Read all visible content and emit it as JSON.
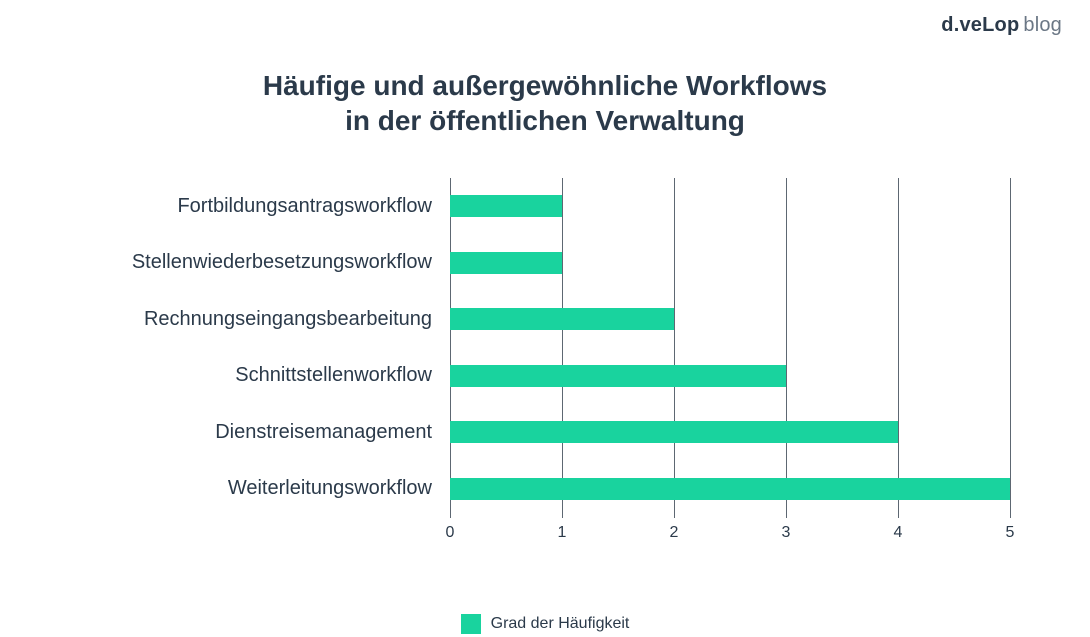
{
  "brand": {
    "bold": "d.veLop",
    "light": "blog"
  },
  "title": {
    "line1": "Häufige und außergewöhnliche Workflows",
    "line2": "in der öffentlichen Verwaltung"
  },
  "legend": {
    "label": "Grad der Häufigkeit"
  },
  "chart_data": {
    "type": "bar",
    "orientation": "horizontal",
    "categories": [
      "Fortbildungsantragsworkflow",
      "Stellenwiederbesetzungsworkflow",
      "Rechnungseingangsbearbeitung",
      "Schnittstellenworkflow",
      "Dienstreisemanagement",
      "Weiterleitungsworkflow"
    ],
    "values": [
      1,
      1,
      2,
      3,
      4,
      5
    ],
    "series_name": "Grad der Häufigkeit",
    "xlabel": "",
    "ylabel": "",
    "xlim": [
      0,
      5
    ],
    "x_ticks": [
      0,
      1,
      2,
      3,
      4,
      5
    ],
    "bar_color": "#19d39e",
    "grid": {
      "vertical": true,
      "horizontal": false
    }
  }
}
